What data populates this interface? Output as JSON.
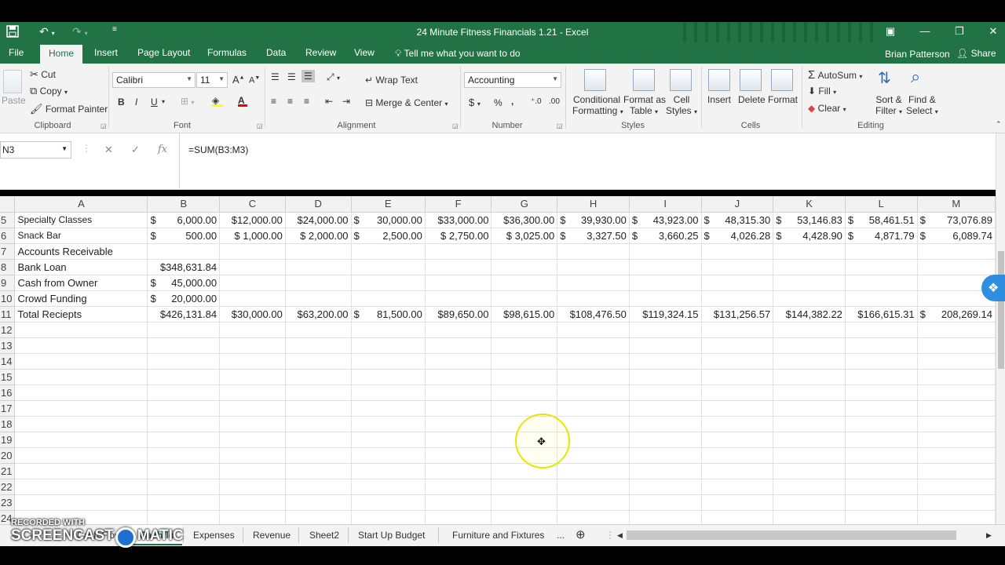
{
  "window": {
    "title": "24 Minute Fitness Financials 1.21 - Excel",
    "controls": {
      "ribbon_display": "▣",
      "minimize": "—",
      "restore": "❐",
      "close": "✕"
    }
  },
  "ribbon_tabs": [
    "File",
    "Home",
    "Insert",
    "Page Layout",
    "Formulas",
    "Data",
    "Review",
    "View"
  ],
  "active_tab": "Home",
  "tell_me": "Tell me what you want to do",
  "user_name": "Brian Patterson",
  "share_label": "Share",
  "ribbon": {
    "clipboard": {
      "paste": "Paste",
      "cut": "Cut",
      "copy": "Copy",
      "format_painter": "Format Painter",
      "label": "Clipboard"
    },
    "font": {
      "name": "Calibri",
      "size": "11",
      "label": "Font",
      "bold": "B",
      "italic": "I",
      "underline": "U"
    },
    "alignment": {
      "wrap_text": "Wrap Text",
      "merge_center": "Merge & Center",
      "label": "Alignment"
    },
    "number": {
      "format": "Accounting",
      "label": "Number",
      "dollar": "$",
      "percent": "%",
      "comma": ","
    },
    "styles": {
      "conditional_formatting": [
        "Conditional",
        "Formatting"
      ],
      "format_as_table": [
        "Format as",
        "Table"
      ],
      "cell_styles": [
        "Cell",
        "Styles"
      ],
      "label": "Styles"
    },
    "cells": {
      "insert": "Insert",
      "delete": "Delete",
      "format": "Format",
      "label": "Cells"
    },
    "editing": {
      "autosum": "AutoSum",
      "fill": "Fill",
      "clear": "Clear",
      "sort_filter": [
        "Sort &",
        "Filter"
      ],
      "find_select": [
        "Find &",
        "Select"
      ],
      "label": "Editing"
    }
  },
  "formula_bar": {
    "name_box": "N3",
    "formula": "=SUM(B3:M3)",
    "fx": "fx",
    "cancel": "✕",
    "enter": "✓"
  },
  "columns": [
    "A",
    "B",
    "C",
    "D",
    "E",
    "F",
    "G",
    "H",
    "I",
    "J",
    "K",
    "L",
    "M"
  ],
  "rows": [
    {
      "num": "5",
      "small": true,
      "cells": [
        "Specialty Classes",
        "$|6,000.00",
        "$12,000.00",
        "$24,000.00",
        "$|30,000.00",
        "$33,000.00",
        "$36,300.00",
        "$|39,930.00",
        "$|43,923.00",
        "$|48,315.30",
        "$|53,146.83",
        "$|58,461.51",
        "$|73,076.89"
      ]
    },
    {
      "num": "6",
      "small": true,
      "cells": [
        "Snack Bar",
        "$|500.00",
        "$ 1,000.00",
        "$ 2,000.00",
        "$|2,500.00",
        "$ 2,750.00",
        "$ 3,025.00",
        "$|3,327.50",
        "$|3,660.25",
        "$|4,026.28",
        "$|4,428.90",
        "$|4,871.79",
        "$|6,089.74"
      ]
    },
    {
      "num": "7",
      "small": false,
      "cells": [
        "Accounts Receivable",
        "",
        "",
        "",
        "",
        "",
        "",
        "",
        "",
        "",
        "",
        "",
        ""
      ]
    },
    {
      "num": "8",
      "small": false,
      "cells": [
        "Bank Loan",
        "$348,631.84",
        "",
        "",
        "",
        "",
        "",
        "",
        "",
        "",
        "",
        "",
        ""
      ]
    },
    {
      "num": "9",
      "small": false,
      "cells": [
        "Cash from Owner",
        "$|45,000.00",
        "",
        "",
        "",
        "",
        "",
        "",
        "",
        "",
        "",
        "",
        ""
      ]
    },
    {
      "num": "10",
      "small": false,
      "cells": [
        "Crowd Funding",
        "$|20,000.00",
        "",
        "",
        "",
        "",
        "",
        "",
        "",
        "",
        "",
        "",
        ""
      ]
    },
    {
      "num": "11",
      "small": false,
      "cells": [
        "Total Reciepts",
        "$426,131.84",
        "$30,000.00",
        "$63,200.00",
        "$|81,500.00",
        "$89,650.00",
        "$98,615.00",
        "$108,476.50",
        "$119,324.15",
        "$131,256.57",
        "$144,382.22",
        "$166,615.31",
        "$|208,269.14"
      ]
    },
    {
      "num": "12",
      "small": false,
      "cells": []
    },
    {
      "num": "13",
      "small": false,
      "cells": []
    },
    {
      "num": "14",
      "small": false,
      "cells": []
    },
    {
      "num": "15",
      "small": false,
      "cells": []
    },
    {
      "num": "16",
      "small": false,
      "cells": []
    },
    {
      "num": "17",
      "small": false,
      "cells": []
    },
    {
      "num": "18",
      "small": false,
      "cells": []
    },
    {
      "num": "19",
      "small": false,
      "cells": []
    },
    {
      "num": "20",
      "small": false,
      "cells": []
    },
    {
      "num": "21",
      "small": false,
      "cells": []
    },
    {
      "num": "22",
      "small": false,
      "cells": []
    },
    {
      "num": "23",
      "small": false,
      "cells": []
    },
    {
      "num": "24",
      "small": false,
      "cells": []
    }
  ],
  "sheet_tabs": [
    "Cash Flow",
    "Cashflo",
    "Expenses",
    "Revenue",
    "Sheet2",
    "Start Up Budget",
    "Furniture and Fixtures"
  ],
  "active_sheet": "Cashflo",
  "more_sheets": "...",
  "add_sheet": "⊕",
  "watermark": {
    "line1": "RECORDED WITH",
    "part1": "SCREENCAST",
    "part2": "MATIC"
  },
  "icons": {
    "save": "save-icon",
    "undo": "undo-icon",
    "redo": "redo-icon",
    "lightbulb": "lightbulb-icon",
    "dropbox": "dropbox-icon"
  },
  "colors": {
    "accent": "#217346",
    "cursor_ring": "#e8e600"
  }
}
